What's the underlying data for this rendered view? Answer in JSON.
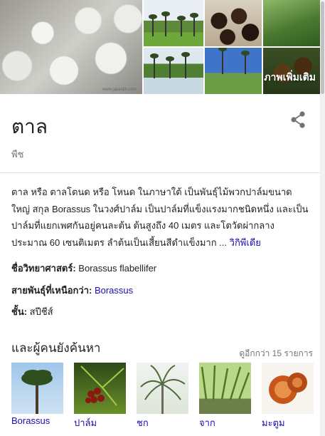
{
  "photos": {
    "watermark": "www.japaojin.com",
    "more_label": "ภาพเพิ่มเติม"
  },
  "header": {
    "title": "ตาล",
    "subtitle": "พืช",
    "share_icon": "share-icon"
  },
  "description": {
    "text": "ตาล หรือ ตาลโตนด หรือ โหนด ในภาษาใต้ เป็นพันธุ์ไม้พวกปาล์มขนาดใหญ่ สกุล Borassus ในวงศ์ปาล์ม เป็นปาล์มที่แข็งแรงมากชนิดหนึ่ง และเป็นปาล์มที่แยกเพศกันอยู่คนละต้น ต้นสูงถึง 40 เมตร และโตวัดผ่ากลางประมาณ 60 เซนติเมตร ลำต้นเป็นเสี้ยนสีดำแข็งมาก ...",
    "source_link": "วิกิพีเดีย"
  },
  "facts": {
    "scientific_name_label": "ชื่อวิทยาศาสตร์:",
    "scientific_name_value": "Borassus flabellifer",
    "parent_label": "สายพันธุ์ที่เหนือกว่า:",
    "parent_value": "Borassus",
    "rank_label": "ชั้น:",
    "rank_value": "สปีชีส์"
  },
  "related": {
    "title": "และผู้คนยังค้นหา",
    "more": "ดูอีกกว่า 15 รายการ",
    "items": [
      {
        "label": "Borassus"
      },
      {
        "label": "ปาล์ม"
      },
      {
        "label": "ชก"
      },
      {
        "label": "จาก"
      },
      {
        "label": "มะตูม"
      }
    ]
  },
  "colors": {
    "link": "#1a0dab",
    "secondary_text": "#70757a",
    "divider": "#dfe1e5"
  }
}
